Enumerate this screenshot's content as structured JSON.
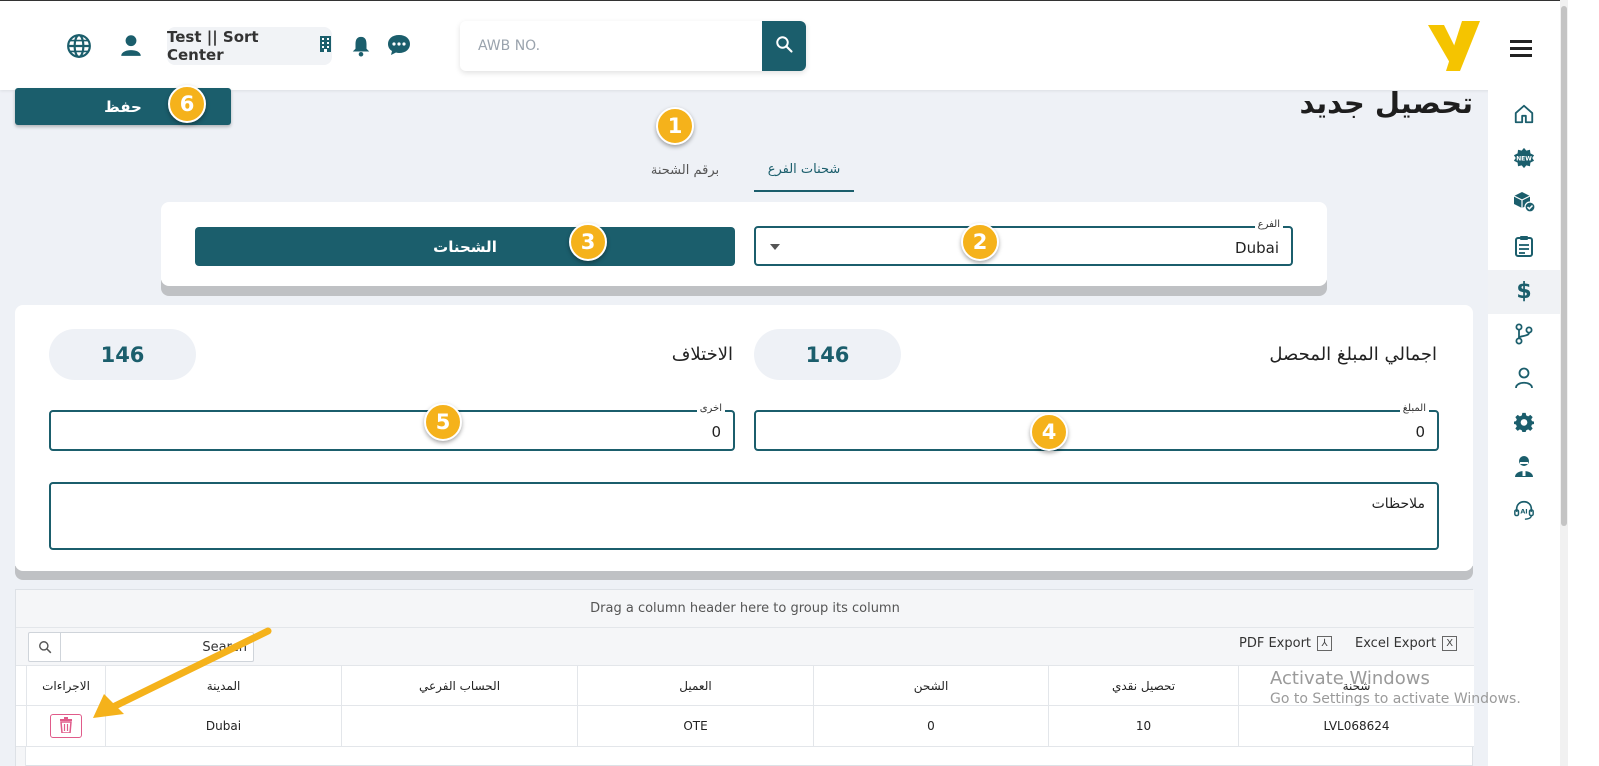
{
  "topbar": {
    "branch_chip": "Test || Sort Center",
    "search_placeholder": "AWB NO."
  },
  "page": {
    "title": "تحصيل جديد",
    "save_label": "حفظ",
    "tabs": [
      {
        "label": "شحنات الفرع",
        "active": true
      },
      {
        "label": "برقم الشحنة",
        "active": false
      }
    ]
  },
  "filter": {
    "branch_label": "الفرع",
    "branch_value": "Dubai",
    "shipments_button": "الشحنات"
  },
  "totals": {
    "total_collected_label": "اجمالي المبلغ المحصل",
    "total_collected_value": "146",
    "difference_label": "الاختلاف",
    "difference_value": "146",
    "amount_label": "المبلغ",
    "amount_value": "0",
    "other_label": "اخرى",
    "other_value": "0",
    "notes_placeholder": "ملاحظات"
  },
  "grid": {
    "group_hint": "Drag a column header here to group its column",
    "search_placeholder": "Search",
    "pdf_export": "PDF Export",
    "excel_export": "Excel Export",
    "columns": [
      "شحنة",
      "تحصيل نقدي",
      "الشحن",
      "العميل",
      "الحساب الفرعي",
      "المدينة",
      "الاجراءات"
    ],
    "rows": [
      {
        "awb": "LVL068624",
        "cash": "10",
        "shipping": "0",
        "customer": "OTE",
        "sub_account": "",
        "city": "Dubai"
      }
    ]
  },
  "watermark": {
    "line1": "Activate Windows",
    "line2": "Go to Settings to activate Windows."
  },
  "callouts": [
    "1",
    "2",
    "3",
    "4",
    "5",
    "6"
  ],
  "icons": {
    "top": [
      "globe-icon",
      "user-icon",
      "building-icon",
      "bell-icon",
      "chat-icon",
      "search-icon"
    ],
    "sidebar": [
      "home-icon",
      "new-badge-icon",
      "package-check-icon",
      "clipboard-icon",
      "dollar-icon",
      "branch-icon",
      "user-icon",
      "gear-icon",
      "agent-icon",
      "ai-support-icon"
    ]
  },
  "colors": {
    "primary": "#1b5e6c",
    "brand_yellow": "#f5c400",
    "callout": "#f5b21b",
    "delete": "#e05b8a"
  }
}
